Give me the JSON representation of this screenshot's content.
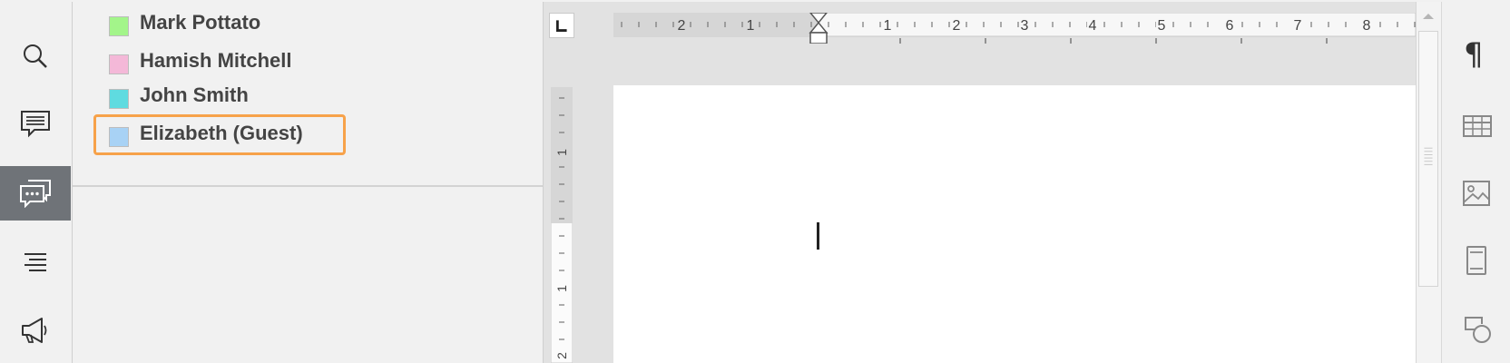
{
  "left_sidebar": {
    "buttons": [
      {
        "name": "search-icon",
        "active": false
      },
      {
        "name": "comments-icon",
        "active": false
      },
      {
        "name": "chat-icon",
        "active": true
      },
      {
        "name": "navigation-icon",
        "active": false
      },
      {
        "name": "announcement-icon",
        "active": false
      }
    ]
  },
  "users_panel": {
    "users": [
      {
        "name": "Mark Pottato",
        "color": "#a3f58a"
      },
      {
        "name": "Hamish Mitchell",
        "color": "#f4b8d8"
      },
      {
        "name": "John Smith",
        "color": "#5fdbe0"
      },
      {
        "name": "Elizabeth (Guest)",
        "color": "#a8d2f5",
        "selected": true
      }
    ],
    "highlight_color": "#f7a24a"
  },
  "horizontal_ruler": {
    "labels": [
      "2",
      "1",
      "1",
      "2",
      "3",
      "4",
      "5",
      "6",
      "7",
      "8"
    ]
  },
  "vertical_ruler": {
    "labels": [
      "1",
      "1",
      "2"
    ]
  },
  "right_sidebar": {
    "buttons": [
      {
        "name": "paragraph-icon",
        "glyph": "¶"
      },
      {
        "name": "table-icon"
      },
      {
        "name": "image-icon"
      },
      {
        "name": "page-icon"
      },
      {
        "name": "shape-icon"
      }
    ]
  },
  "colors": {
    "panel_bg": "#f1f1f1",
    "active_bg": "#6f7378",
    "doc_bg": "#e2e2e2",
    "page_bg": "#ffffff"
  }
}
